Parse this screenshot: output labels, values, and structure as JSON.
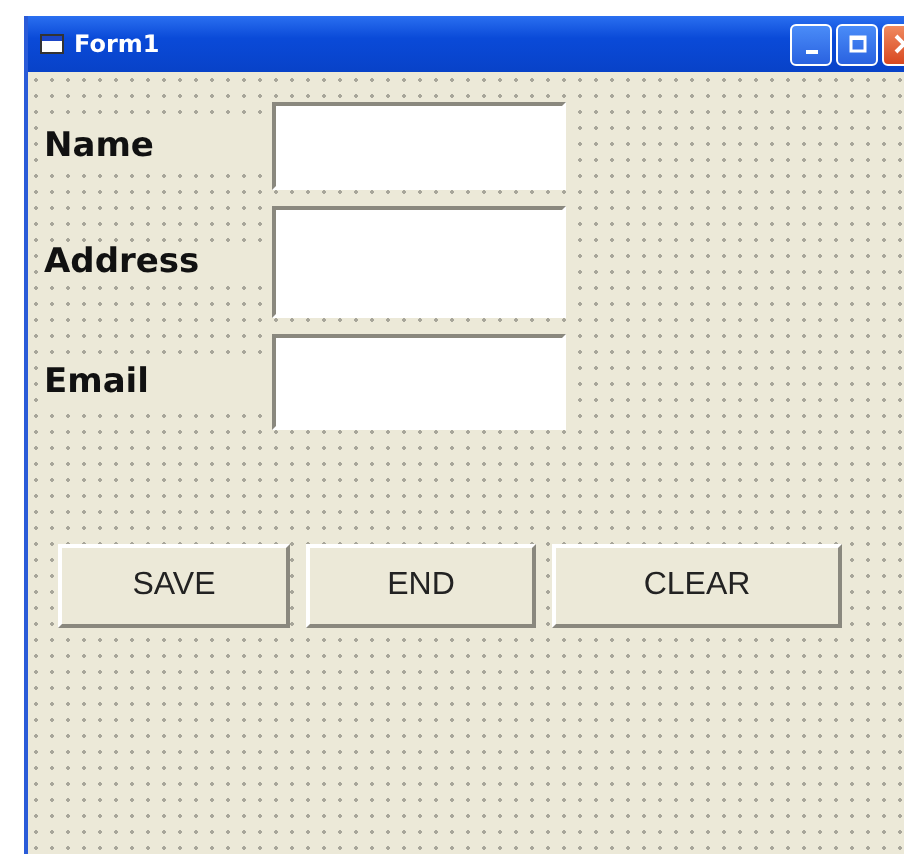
{
  "window": {
    "title": "Form1"
  },
  "fields": [
    {
      "label": "Name"
    },
    {
      "label": "Address"
    },
    {
      "label": "Email"
    }
  ],
  "buttons": [
    {
      "label": "SAVE"
    },
    {
      "label": "END"
    },
    {
      "label": "CLEAR"
    }
  ]
}
